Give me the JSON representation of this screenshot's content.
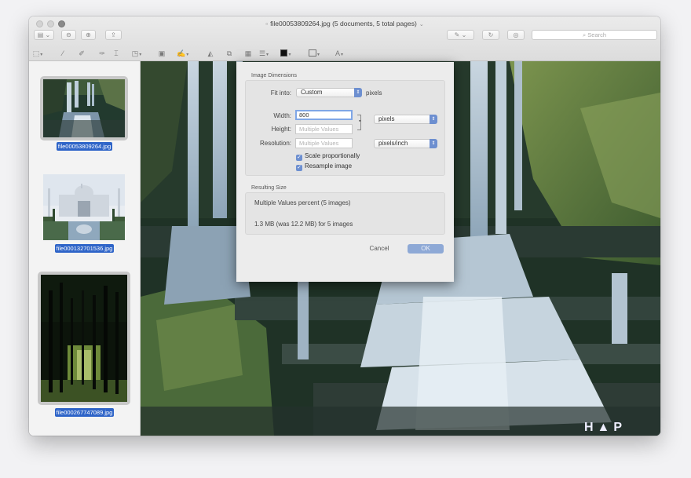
{
  "window": {
    "title": "file00053809264.jpg (5 documents, 5 total pages)"
  },
  "toolbar": {
    "search_placeholder": "Search"
  },
  "sidebar": {
    "items": [
      {
        "label": "file00053809264.jpg"
      },
      {
        "label": "file000132701536.jpg"
      },
      {
        "label": "file000267747089.jpg"
      }
    ],
    "add_label": "+"
  },
  "viewer": {
    "watermark": "H▲P"
  },
  "dialog": {
    "image_dimensions_title": "Image Dimensions",
    "fit_into_label": "Fit into:",
    "fit_into_value": "Custom",
    "fit_into_unit": "pixels",
    "width_label": "Width:",
    "width_value": "800",
    "height_label": "Height:",
    "height_placeholder": "Multiple Values",
    "size_unit": "pixels",
    "resolution_label": "Resolution:",
    "resolution_placeholder": "Multiple Values",
    "resolution_unit": "pixels/inch",
    "scale_label": "Scale proportionally",
    "scale_checked": true,
    "resample_label": "Resample image",
    "resample_checked": true,
    "resulting_size_title": "Resulting Size",
    "result_line1": "Multiple Values percent (5 images)",
    "result_line2": "1.3 MB (was 12.2 MB) for 5 images",
    "cancel_label": "Cancel",
    "ok_label": "OK"
  },
  "colors": {
    "accent": "#6d8fd0",
    "selection": "#2e64c8"
  }
}
